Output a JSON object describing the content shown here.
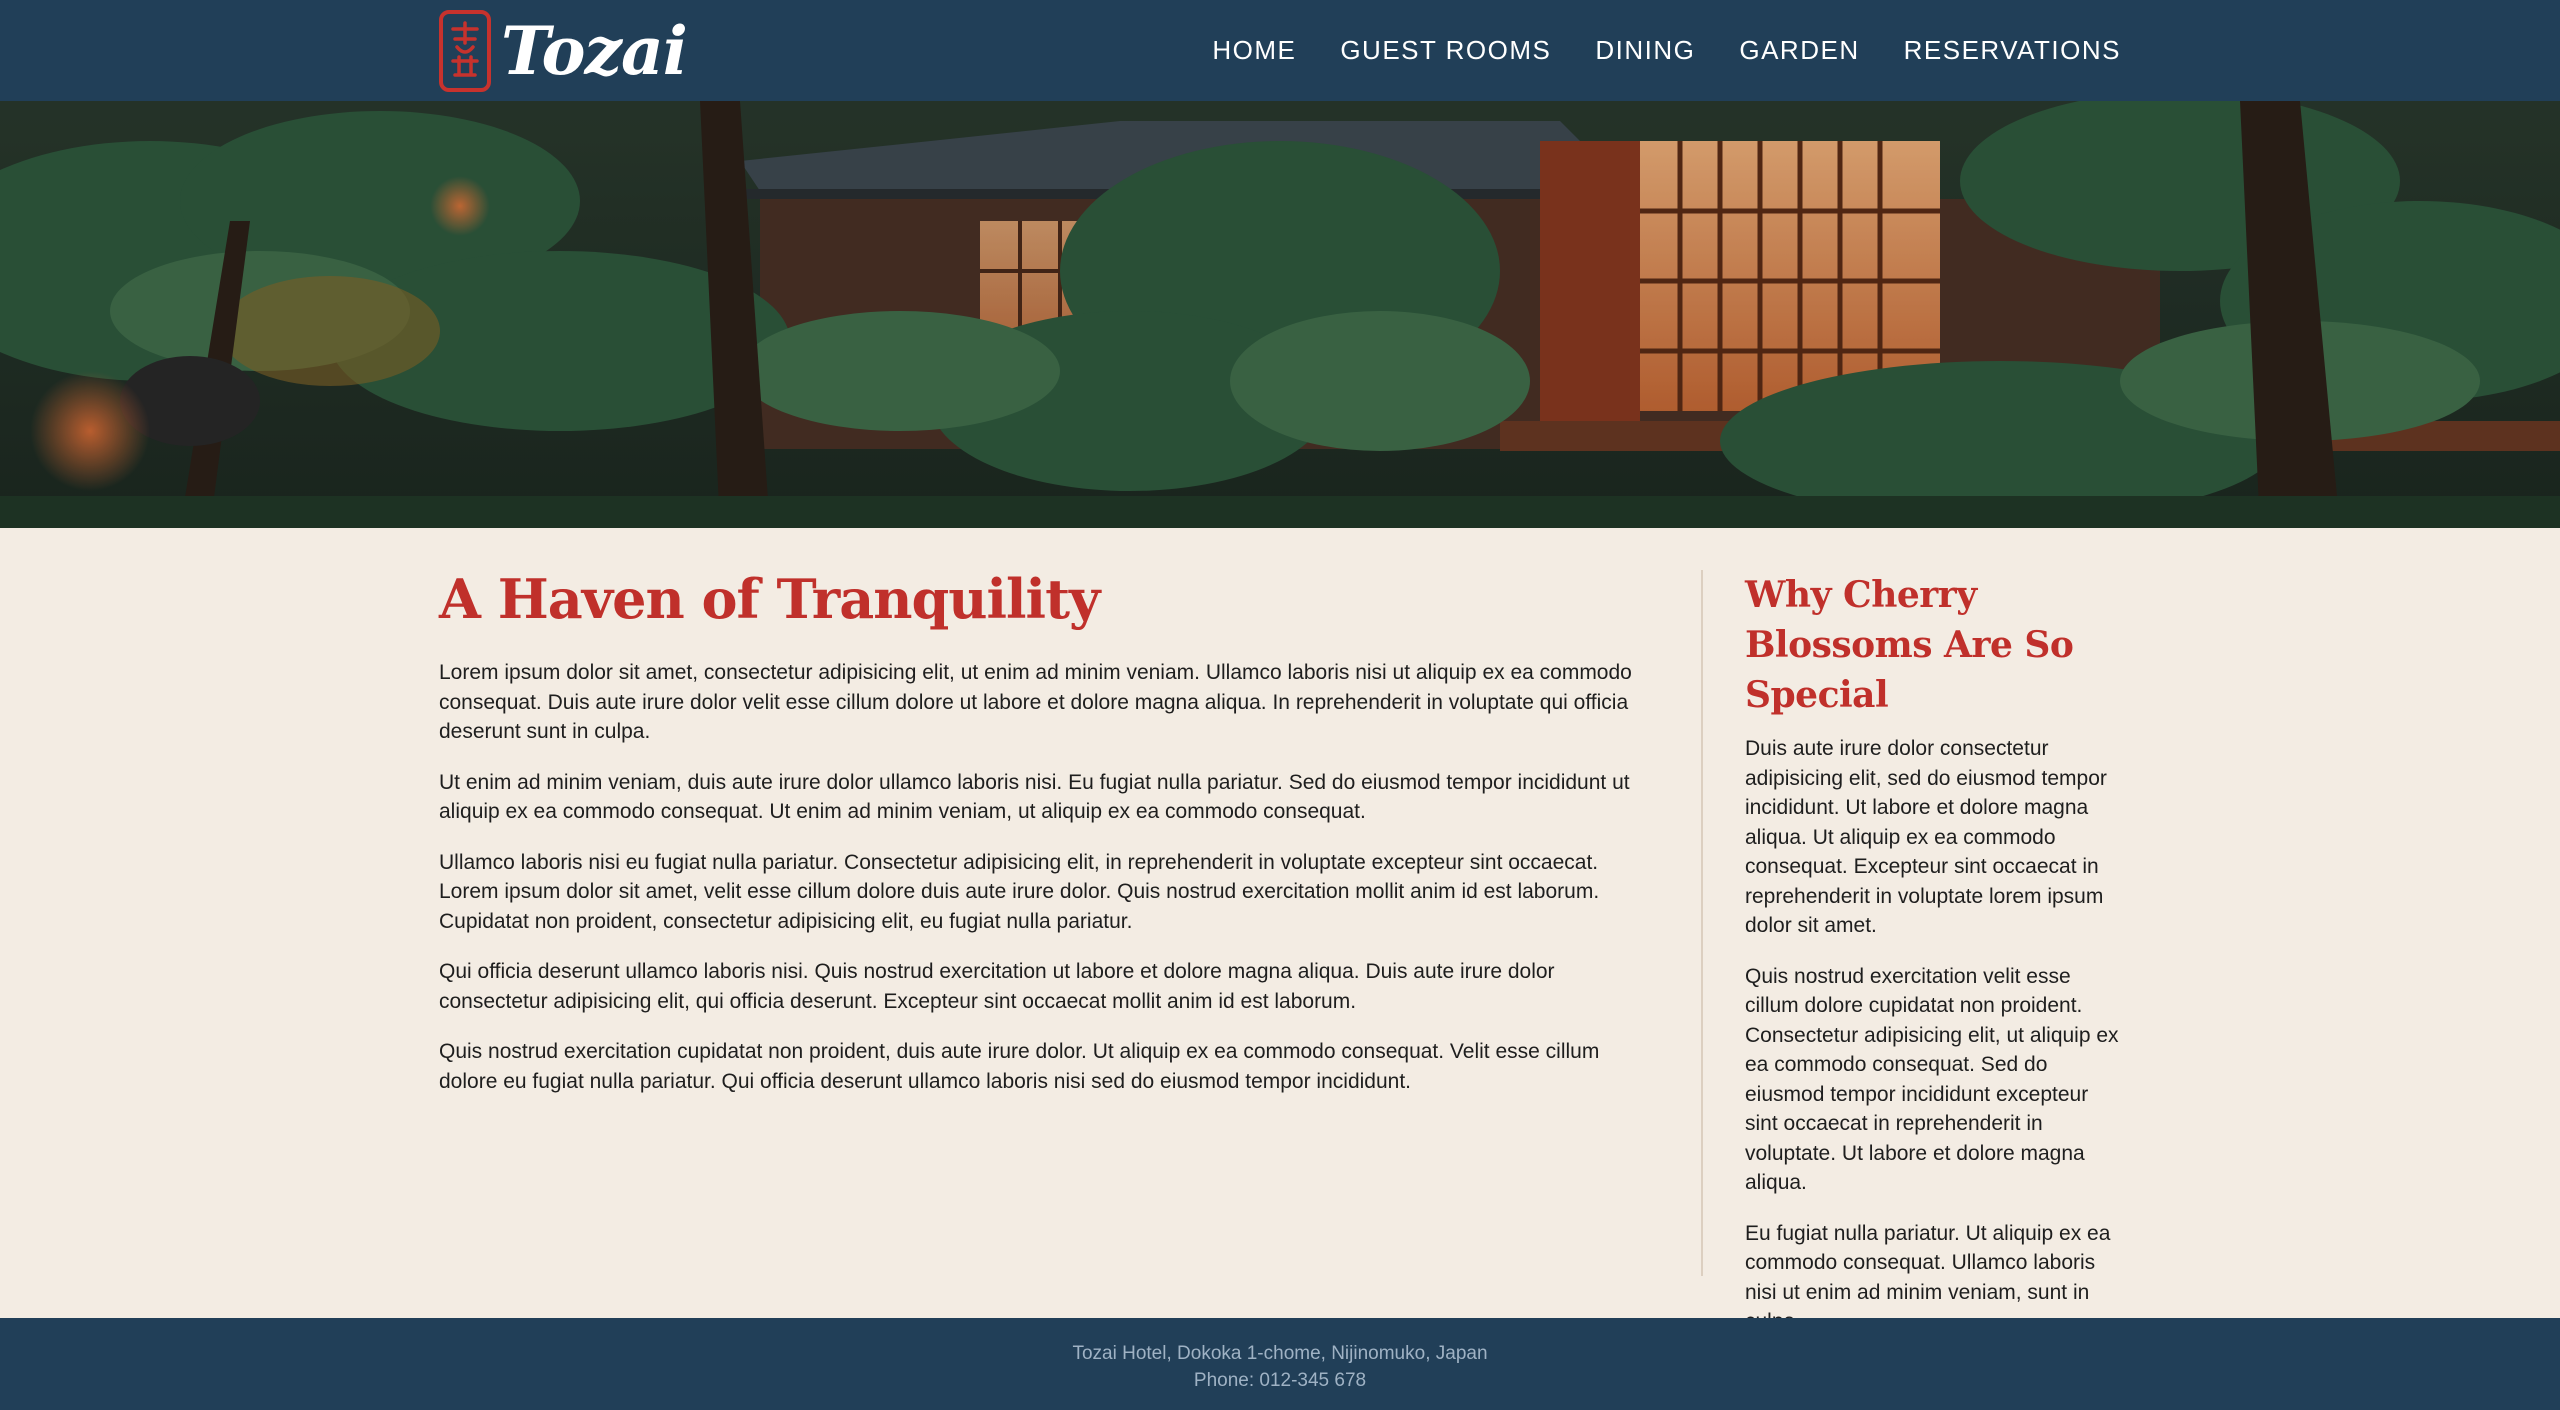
{
  "brand": {
    "name": "Tozai",
    "logo_icon": "hanko-seal-icon",
    "accent_color": "#c0302b",
    "header_color": "#213f58"
  },
  "nav": {
    "items": [
      {
        "label": "HOME"
      },
      {
        "label": "GUEST ROOMS"
      },
      {
        "label": "DINING"
      },
      {
        "label": "GARDEN"
      },
      {
        "label": "RESERVATIONS"
      }
    ]
  },
  "main": {
    "title": "A Haven of Tranquility",
    "paragraphs": [
      "Lorem ipsum dolor sit amet, consectetur adipisicing elit, ut enim ad minim veniam. Ullamco laboris nisi ut aliquip ex ea commodo consequat. Duis aute irure dolor velit esse cillum dolore ut labore et dolore magna aliqua. In reprehenderit in voluptate qui officia deserunt sunt in culpa.",
      "Ut enim ad minim veniam, duis aute irure dolor ullamco laboris nisi. Eu fugiat nulla pariatur. Sed do eiusmod tempor incididunt ut aliquip ex ea commodo consequat. Ut enim ad minim veniam, ut aliquip ex ea commodo consequat.",
      "Ullamco laboris nisi eu fugiat nulla pariatur. Consectetur adipisicing elit, in reprehenderit in voluptate excepteur sint occaecat. Lorem ipsum dolor sit amet, velit esse cillum dolore duis aute irure dolor. Quis nostrud exercitation mollit anim id est laborum. Cupidatat non proident, consectetur adipisicing elit, eu fugiat nulla pariatur.",
      "Qui officia deserunt ullamco laboris nisi. Quis nostrud exercitation ut labore et dolore magna aliqua. Duis aute irure dolor consectetur adipisicing elit, qui officia deserunt. Excepteur sint occaecat mollit anim id est laborum.",
      "Quis nostrud exercitation cupidatat non proident, duis aute irure dolor. Ut aliquip ex ea commodo consequat. Velit esse cillum dolore eu fugiat nulla pariatur. Qui officia deserunt ullamco laboris nisi sed do eiusmod tempor incididunt."
    ]
  },
  "sidebar": {
    "title": "Why Cherry Blossoms Are So Special",
    "paragraphs": [
      "Duis aute irure dolor consectetur adipisicing elit, sed do eiusmod tempor incididunt. Ut labore et dolore magna aliqua. Ut aliquip ex ea commodo consequat. Excepteur sint occaecat in reprehenderit in voluptate lorem ipsum dolor sit amet.",
      "Quis nostrud exercitation velit esse cillum dolore cupidatat non proident. Consectetur adipisicing elit, ut aliquip ex ea commodo consequat. Sed do eiusmod tempor incididunt excepteur sint occaecat in reprehenderit in voluptate. Ut labore et dolore magna aliqua.",
      "Eu fugiat nulla pariatur. Ut aliquip ex ea commodo consequat. Ullamco laboris nisi ut enim ad minim veniam, sunt in culpa."
    ]
  },
  "footer": {
    "address": "Tozai Hotel, Dokoka 1-chome, Nijinomuko, Japan",
    "phone": "Phone: 012-345 678"
  }
}
